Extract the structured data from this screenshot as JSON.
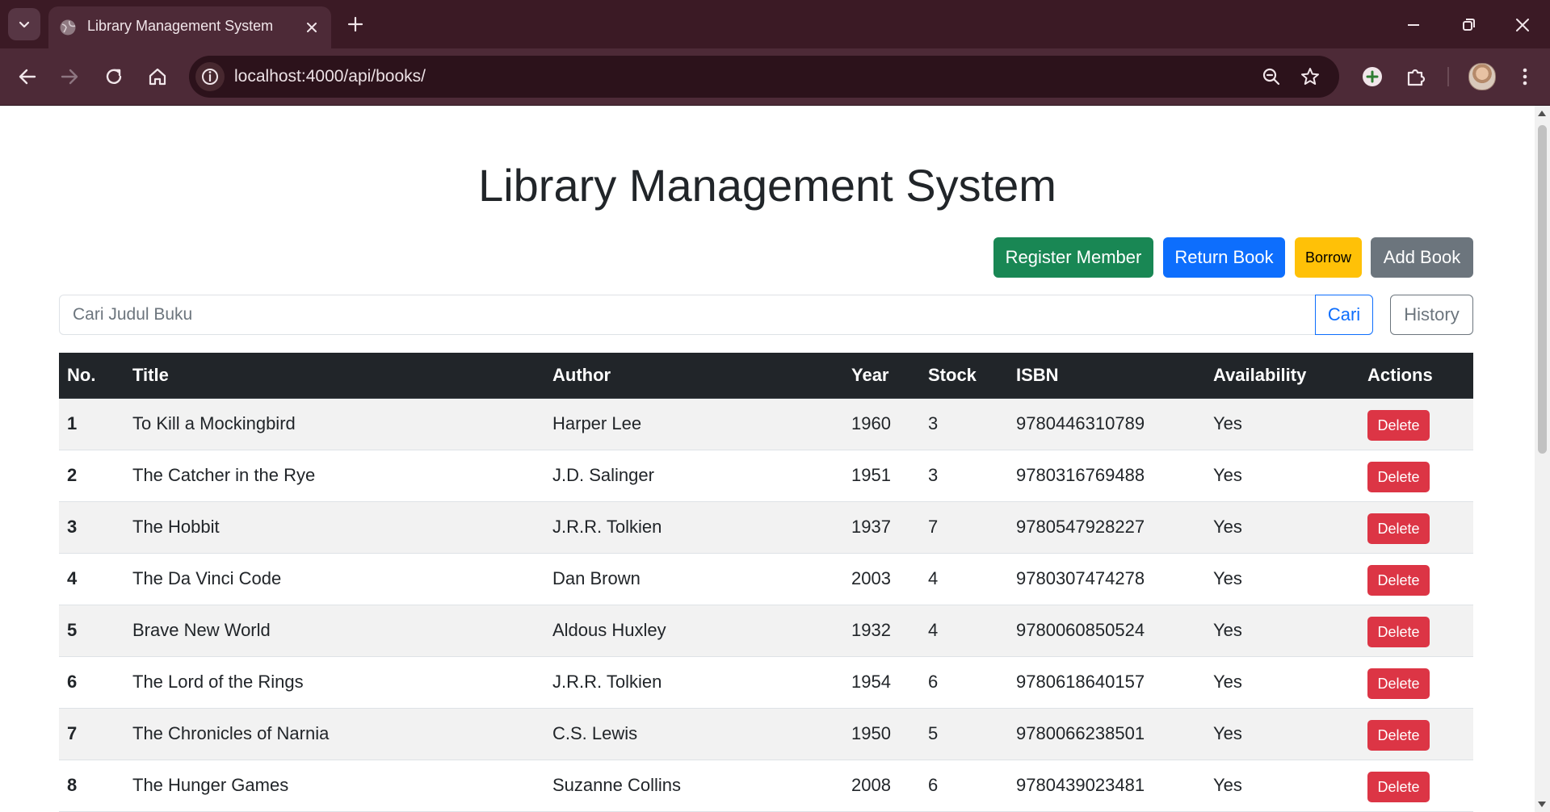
{
  "browser": {
    "tab_title": "Library Management System",
    "url": "localhost:4000/api/books/"
  },
  "page": {
    "title": "Library Management System",
    "buttons": {
      "register_member": "Register Member",
      "return_book": "Return Book",
      "borrow": "Borrow",
      "add_book": "Add Book"
    },
    "search": {
      "placeholder": "Cari Judul Buku",
      "submit_label": "Cari",
      "history_label": "History"
    }
  },
  "table": {
    "headers": [
      "No.",
      "Title",
      "Author",
      "Year",
      "Stock",
      "ISBN",
      "Availability",
      "Actions"
    ],
    "rows": [
      {
        "no": "1",
        "title": "To Kill a Mockingbird",
        "author": "Harper Lee",
        "year": "1960",
        "stock": "3",
        "isbn": "9780446310789",
        "availability": "Yes",
        "action": "Delete"
      },
      {
        "no": "2",
        "title": "The Catcher in the Rye",
        "author": "J.D. Salinger",
        "year": "1951",
        "stock": "3",
        "isbn": "9780316769488",
        "availability": "Yes",
        "action": "Delete"
      },
      {
        "no": "3",
        "title": "The Hobbit",
        "author": "J.R.R. Tolkien",
        "year": "1937",
        "stock": "7",
        "isbn": "9780547928227",
        "availability": "Yes",
        "action": "Delete"
      },
      {
        "no": "4",
        "title": "The Da Vinci Code",
        "author": "Dan Brown",
        "year": "2003",
        "stock": "4",
        "isbn": "9780307474278",
        "availability": "Yes",
        "action": "Delete"
      },
      {
        "no": "5",
        "title": "Brave New World",
        "author": "Aldous Huxley",
        "year": "1932",
        "stock": "4",
        "isbn": "9780060850524",
        "availability": "Yes",
        "action": "Delete"
      },
      {
        "no": "6",
        "title": "The Lord of the Rings",
        "author": "J.R.R. Tolkien",
        "year": "1954",
        "stock": "6",
        "isbn": "9780618640157",
        "availability": "Yes",
        "action": "Delete"
      },
      {
        "no": "7",
        "title": "The Chronicles of Narnia",
        "author": "C.S. Lewis",
        "year": "1950",
        "stock": "5",
        "isbn": "9780066238501",
        "availability": "Yes",
        "action": "Delete"
      },
      {
        "no": "8",
        "title": "The Hunger Games",
        "author": "Suzanne Collins",
        "year": "2008",
        "stock": "6",
        "isbn": "9780439023481",
        "availability": "Yes",
        "action": "Delete"
      }
    ]
  },
  "colors": {
    "chrome_frame": "#3b1a25",
    "chrome_toolbar": "#4d2a37",
    "success": "#198754",
    "primary": "#0d6efd",
    "warning": "#ffc107",
    "secondary": "#6c757d",
    "danger": "#dc3545",
    "table_header": "#212529"
  },
  "icons": [
    "tab-list-icon",
    "globe-icon",
    "close-icon",
    "plus-icon",
    "minimize-icon",
    "restore-icon",
    "window-close-icon",
    "back-icon",
    "forward-icon",
    "reload-icon",
    "home-icon",
    "info-icon",
    "zoom-icon",
    "star-icon",
    "add-extension-icon",
    "extensions-icon",
    "avatar",
    "kebab-menu-icon"
  ]
}
